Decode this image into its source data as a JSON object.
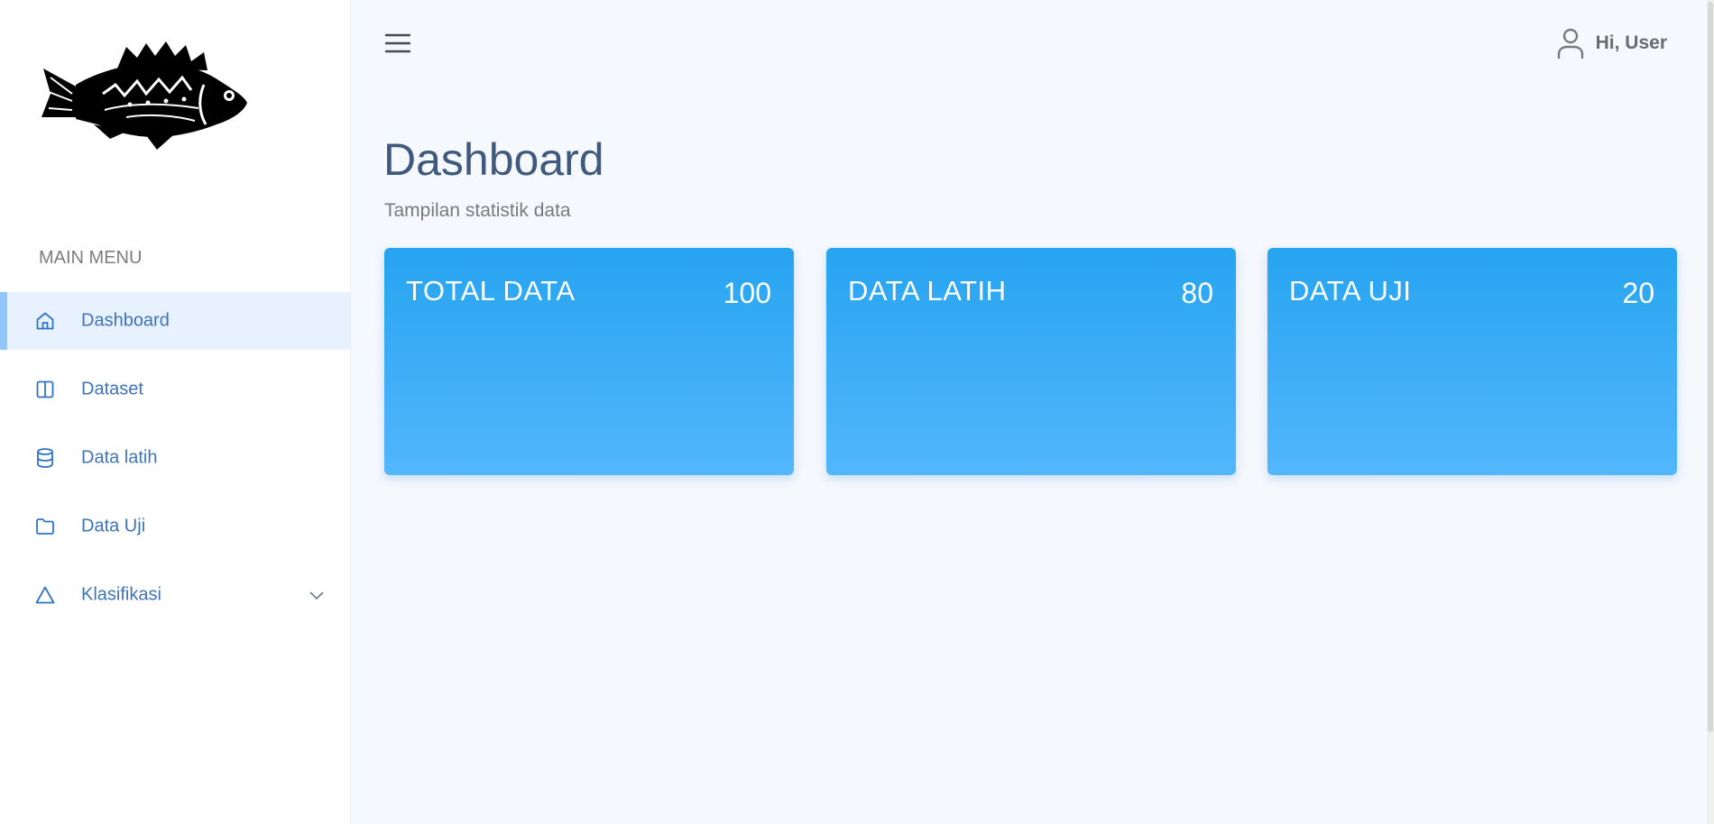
{
  "sidebar": {
    "logo": "fish-logo",
    "menu_heading": "MAIN MENU",
    "items": [
      {
        "label": "Dashboard",
        "icon": "home-icon",
        "active": true
      },
      {
        "label": "Dataset",
        "icon": "columns-icon",
        "active": false
      },
      {
        "label": "Data latih",
        "icon": "database-icon",
        "active": false
      },
      {
        "label": "Data Uji",
        "icon": "folder-icon",
        "active": false
      },
      {
        "label": "Klasifikasi",
        "icon": "triangle-icon",
        "active": false,
        "has_submenu": true
      }
    ]
  },
  "topbar": {
    "menu_icon": "hamburger-icon",
    "user_icon": "user-icon",
    "user_greeting": "Hi, User"
  },
  "header": {
    "title": "Dashboard",
    "subtitle": "Tampilan statistik data"
  },
  "cards": [
    {
      "title": "TOTAL DATA",
      "value": "100"
    },
    {
      "title": "DATA LATIH",
      "value": "80"
    },
    {
      "title": "DATA UJI",
      "value": "20"
    }
  ],
  "colors": {
    "accent": "#3e73b8",
    "card_gradient_top": "#27a4f0",
    "card_gradient_bottom": "#52b6fb",
    "active_bg": "#e8f2fe",
    "active_indicator": "#90c7fb"
  }
}
